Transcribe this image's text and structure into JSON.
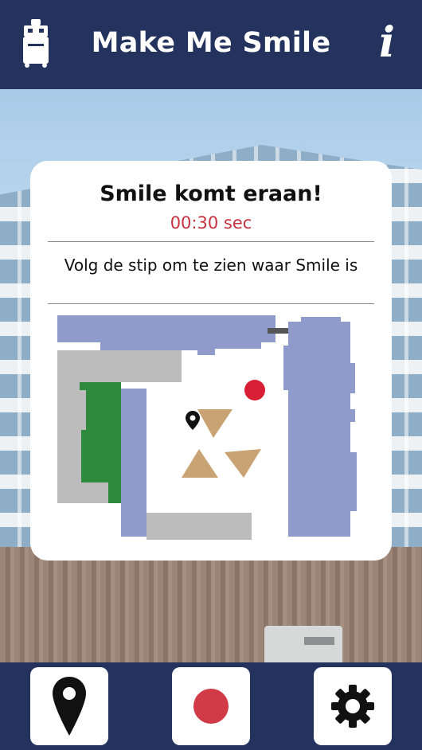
{
  "header": {
    "title": "Make Me Smile",
    "left_icon": "robot-icon",
    "right_icon": "info-icon",
    "info_glyph": "i"
  },
  "card": {
    "title": "Smile komt eraan!",
    "countdown": "00:30 sec",
    "instruction": "Volg de stip om te zien waar Smile is"
  },
  "map": {
    "markers": [
      "location-pin-icon",
      "robot-dot"
    ]
  },
  "bottom_nav": [
    {
      "name": "location",
      "icon": "location-pin-icon"
    },
    {
      "name": "record",
      "icon": "record-dot-icon"
    },
    {
      "name": "settings",
      "icon": "gear-icon"
    }
  ],
  "colors": {
    "navy": "#24335e",
    "accent_red": "#d13a47",
    "map_blue": "#8e9bcb",
    "map_grey": "#bcbcbc",
    "map_green": "#2e8b3e",
    "map_tan": "#c9a373"
  }
}
